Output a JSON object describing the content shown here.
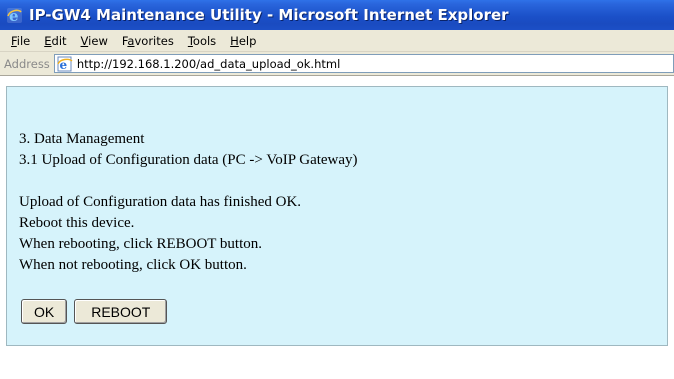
{
  "window": {
    "title": "IP-GW4 Maintenance Utility - Microsoft Internet Explorer",
    "icon": "ie-logo-icon"
  },
  "menubar": {
    "items": [
      {
        "label": "File",
        "accel": "F"
      },
      {
        "label": "Edit",
        "accel": "E"
      },
      {
        "label": "View",
        "accel": "V"
      },
      {
        "label": "Favorites",
        "accel": "a"
      },
      {
        "label": "Tools",
        "accel": "T"
      },
      {
        "label": "Help",
        "accel": "H"
      }
    ]
  },
  "addressbar": {
    "label": "Address",
    "url": "http://192.168.1.200/ad_data_upload_ok.html",
    "icon": "ie-page-icon"
  },
  "page": {
    "section_title": "3. Data Management",
    "subsection_title": "3.1 Upload of Configuration data (PC -> VoIP Gateway)",
    "messages": [
      "Upload of Configuration data has finished OK.",
      "Reboot this device.",
      "When rebooting, click REBOOT button.",
      "When not rebooting, click OK button."
    ],
    "ok_button": "OK",
    "reboot_button": "REBOOT"
  },
  "colors": {
    "titlebar": "#1b50c8",
    "panel_background": "#d6f3fb",
    "chrome": "#ece9d8"
  }
}
